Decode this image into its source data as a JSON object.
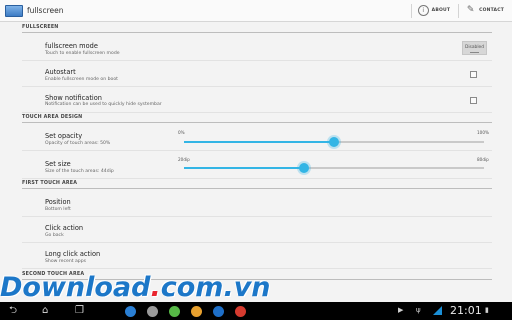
{
  "app": {
    "title": "fullscreen",
    "icon": "window-icon"
  },
  "actions": {
    "about": "ABOUT",
    "contact": "CONTACT"
  },
  "categories": {
    "fullscreen": "FULLSCREEN",
    "touch_design": "TOUCH AREA DESIGN",
    "first_touch": "FIRST TOUCH AREA",
    "second_touch": "SECOND TOUCH AREA"
  },
  "prefs": {
    "fullscreen_mode": {
      "title": "fullscreen mode",
      "summary": "Touch to enable fullscreen mode",
      "button": "Disabled"
    },
    "autostart": {
      "title": "Autostart",
      "summary": "Enable fullscreen mode on boot",
      "checked": false
    },
    "show_notification": {
      "title": "Show notification",
      "summary": "Notification can be used to quickly hide systembar",
      "checked": false
    },
    "set_opacity": {
      "title": "Set opacity",
      "summary": "Opacity of touch areas: 50%",
      "min": "0%",
      "max": "100%",
      "value_fraction": 0.5
    },
    "set_size": {
      "title": "Set size",
      "summary": "Size of the touch areas: 44dip",
      "min": "20dip",
      "max": "80dip",
      "value_fraction": 0.4
    },
    "position": {
      "title": "Position",
      "summary": "Bottom left"
    },
    "click_action": {
      "title": "Click action",
      "summary": "Go back"
    },
    "long_click_action": {
      "title": "Long click action",
      "summary": "Show recent apps"
    }
  },
  "watermark": {
    "part1": "Download",
    "dot": ".",
    "part2": "com.vn"
  },
  "systembar": {
    "time": "21:01",
    "dock_colors": [
      "#2a7fd4",
      "#9a9a9a",
      "#57b947",
      "#e8a12f",
      "#1e6fc8",
      "#d63b2f"
    ],
    "accent": "#33b5e5"
  }
}
